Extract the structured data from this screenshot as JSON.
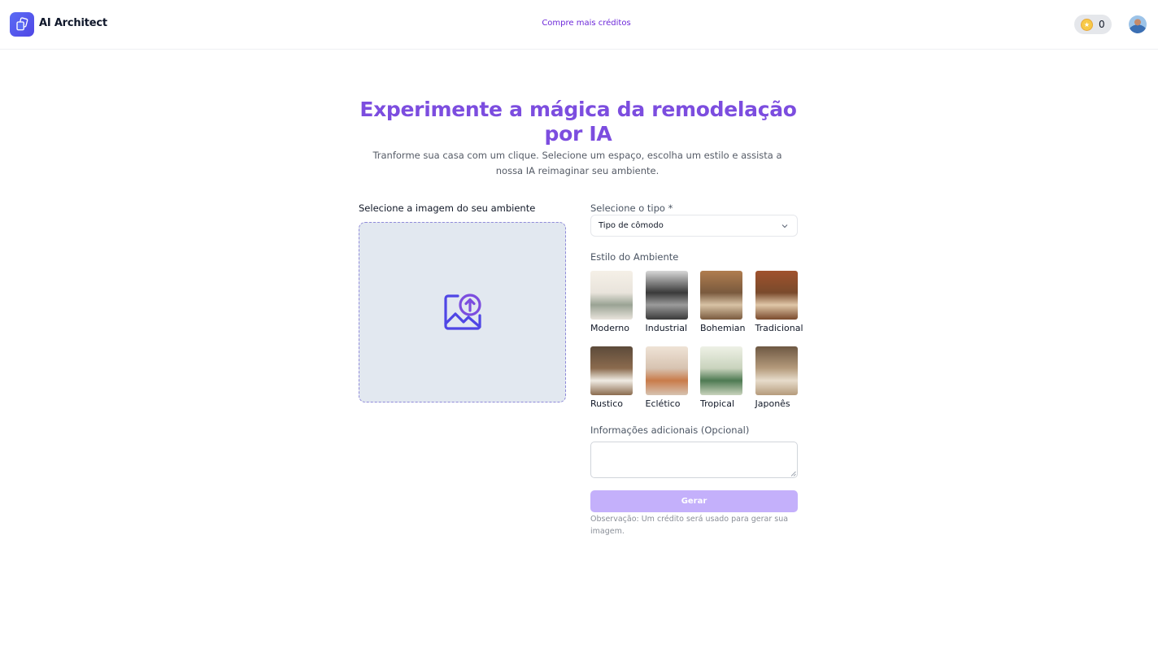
{
  "header": {
    "brand": "AI Architect",
    "buy_credits_link": "Compre mais créditos",
    "credits_count": "0"
  },
  "hero": {
    "title": "Experimente a mágica da remodelação por IA",
    "subtitle": "Tranforme sua casa com um clique. Selecione um espaço, escolha um estilo e assista a nossa IA reimaginar seu ambiente."
  },
  "upload": {
    "label": "Selecione a imagem do seu ambiente"
  },
  "form": {
    "type_label": "Selecione o tipo *",
    "type_select_value": "Tipo de cômodo",
    "style_label": "Estilo do Ambiente",
    "styles": [
      {
        "name": "Moderno",
        "c1": "#e9e4dc",
        "c2": "#9aa394",
        "c3": "#f5f0e7"
      },
      {
        "name": "Industrial",
        "c1": "#3a3a3a",
        "c2": "#9b9b9b",
        "c3": "#d8d8d8"
      },
      {
        "name": "Bohemian",
        "c1": "#7a5a3e",
        "c2": "#d8c3a5",
        "c3": "#b07d4f"
      },
      {
        "name": "Tradicional",
        "c1": "#7a4a2c",
        "c2": "#e0c7a8",
        "c3": "#a0522d"
      },
      {
        "name": "Rustico",
        "c1": "#8b6b4e",
        "c2": "#f0ece4",
        "c3": "#5c4a3a"
      },
      {
        "name": "Eclético",
        "c1": "#d7c3b1",
        "c2": "#c97b4a",
        "c3": "#efe3d6"
      },
      {
        "name": "Tropical",
        "c1": "#c9d3bd",
        "c2": "#4e7a52",
        "c3": "#eef1e6"
      },
      {
        "name": "Japonês",
        "c1": "#b59b7c",
        "c2": "#e7dccb",
        "c3": "#6e5843"
      }
    ],
    "extra_info_label": "Informações adicionais (Opcional)",
    "extra_info_value": "",
    "generate_button": "Gerar",
    "note": "Observação: Um crédito será usado para gerar sua imagem."
  },
  "colors": {
    "accent": "#7c4ddf",
    "button_disabled": "#c4b0fb",
    "upload_bg": "#e2e8f0",
    "upload_icon": "#4f46e5"
  }
}
